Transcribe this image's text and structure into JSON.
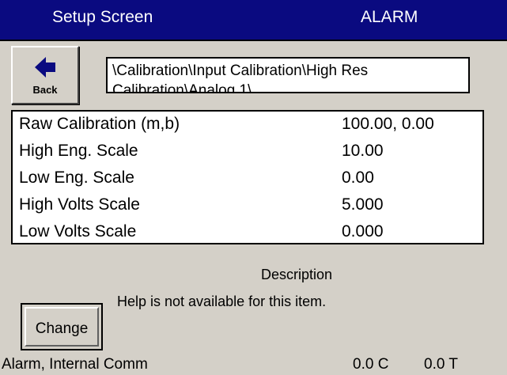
{
  "header": {
    "title": "Setup Screen",
    "alarm": "ALARM"
  },
  "toolbar": {
    "back_label": "Back",
    "back_icon": "arrow-left-icon"
  },
  "path": "\\Calibration\\Input Calibration\\High Res Calibration\\Analog 1\\",
  "settings": [
    {
      "label": "Raw Calibration (m,b)",
      "value": "100.00, 0.00"
    },
    {
      "label": "High Eng. Scale",
      "value": "10.00"
    },
    {
      "label": "Low Eng. Scale",
      "value": "0.00"
    },
    {
      "label": "High Volts Scale",
      "value": "5.000"
    },
    {
      "label": "Low Volts Scale",
      "value": "0.000"
    }
  ],
  "description": {
    "title": "Description",
    "text": "Help is not available for this item."
  },
  "actions": {
    "change_label": "Change"
  },
  "status": {
    "message": "Alarm, Internal Comm",
    "temp_c": "0.0 C",
    "temp_t": "0.0 T"
  },
  "colors": {
    "title_bar": "#0a0a80",
    "panel": "#d4d0c8",
    "list_bg": "#ffffff"
  }
}
